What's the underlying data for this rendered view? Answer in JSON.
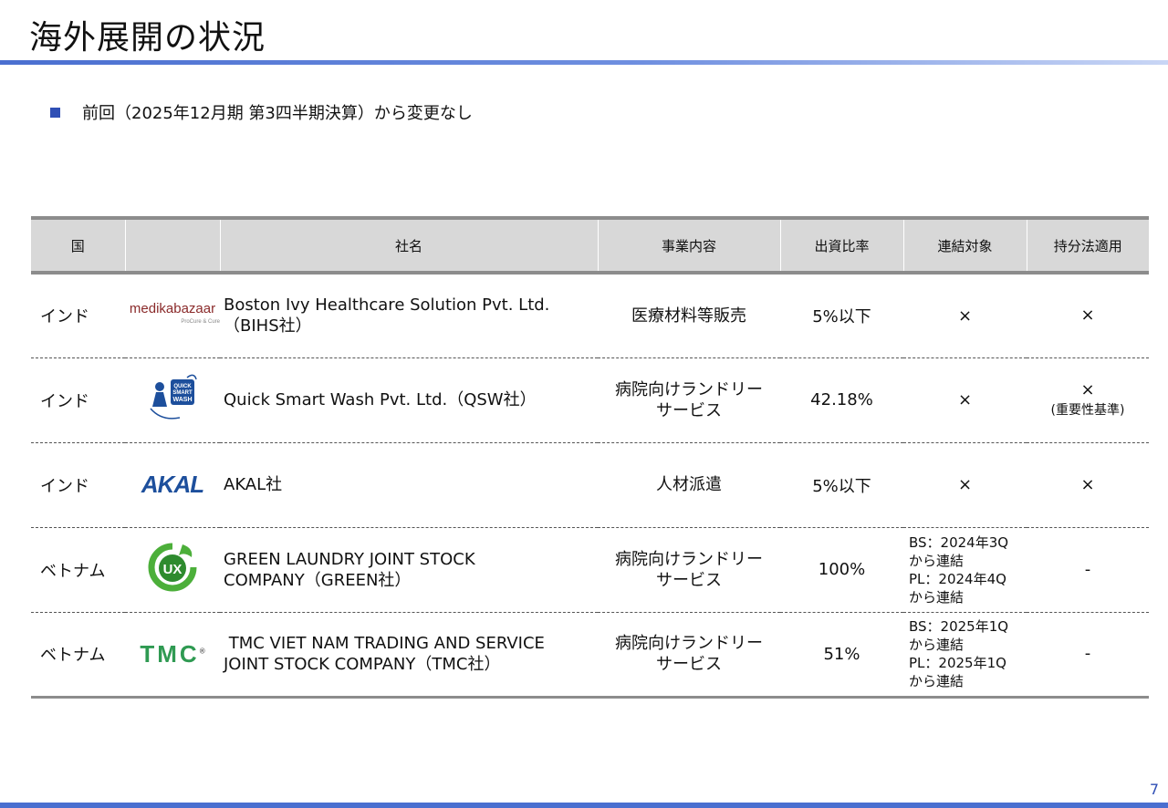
{
  "title": "海外展開の状況",
  "bullet": "前回（2025年12月期 第3四半期決算）から変更なし",
  "table": {
    "headers": [
      "国",
      "",
      "社名",
      "事業内容",
      "出資比率",
      "連結対象",
      "持分法適用"
    ],
    "rows": [
      {
        "country": "インド",
        "logo": "medikabazaar-logo",
        "logo_text": "medikabazaar",
        "company_l1": "Boston Ivy Healthcare Solution Pvt. Ltd.",
        "company_l2": "（BIHS社）",
        "business_l1": "医療材料等販売",
        "business_l2": "",
        "ratio": "5%以下",
        "consol_l1": "×",
        "consol_l2": "",
        "consol_l3": "",
        "consol_l4": "",
        "equity": "×",
        "equity_note": ""
      },
      {
        "country": "インド",
        "logo": "quick-smart-wash-logo",
        "logo_text": "QUICK SMART WASH",
        "company_l1": "Quick Smart Wash Pvt. Ltd.（QSW社）",
        "company_l2": "",
        "business_l1": "病院向けランドリー",
        "business_l2": "サービス",
        "ratio": "42.18%",
        "consol_l1": "×",
        "consol_l2": "",
        "consol_l3": "",
        "consol_l4": "",
        "equity": "×",
        "equity_note": "(重要性基準)"
      },
      {
        "country": "インド",
        "logo": "akal-logo",
        "logo_text": "AKAL",
        "company_l1": "AKAL社",
        "company_l2": "",
        "business_l1": "人材派遣",
        "business_l2": "",
        "ratio": "5%以下",
        "consol_l1": "×",
        "consol_l2": "",
        "consol_l3": "",
        "consol_l4": "",
        "equity": "×",
        "equity_note": ""
      },
      {
        "country": "ベトナム",
        "logo": "green-laundry-logo",
        "logo_text": "UX",
        "company_l1": "GREEN LAUNDRY JOINT STOCK",
        "company_l2": "COMPANY（GREEN社）",
        "business_l1": "病院向けランドリー",
        "business_l2": "サービス",
        "ratio": "100%",
        "consol_l1": "BS：2024年3Q",
        "consol_l2": "から連結",
        "consol_l3": "PL：2024年4Q",
        "consol_l4": "から連結",
        "equity": "-",
        "equity_note": ""
      },
      {
        "country": "ベトナム",
        "logo": "tmc-logo",
        "logo_text": "TMC",
        "company_l1": " TMC VIET NAM TRADING AND SERVICE",
        "company_l2": "JOINT STOCK COMPANY（TMC社）",
        "business_l1": "病院向けランドリー",
        "business_l2": "サービス",
        "ratio": "51%",
        "consol_l1": "BS：2025年1Q",
        "consol_l2": "から連結",
        "consol_l3": "PL：2025年1Q",
        "consol_l4": "から連結",
        "equity": "-",
        "equity_note": ""
      }
    ]
  },
  "page_number": "7",
  "colors": {
    "accent": "#4a6fd0",
    "bullet": "#2f4fb5",
    "header_bg": "#d8d8d8"
  }
}
